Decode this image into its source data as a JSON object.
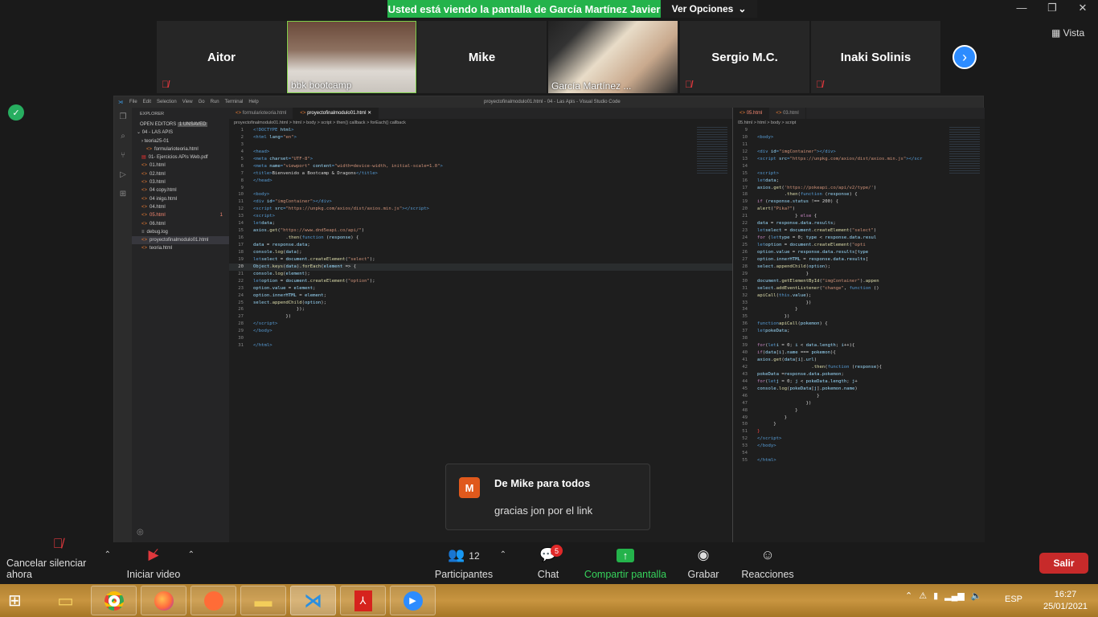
{
  "zoom": {
    "banner": "Usted está viendo la pantalla de García Martínez Javier",
    "view_options": "Ver Opciones",
    "view_label": "Vista",
    "participants": [
      {
        "name": "Aitor",
        "muted": true
      },
      {
        "name": "bbk bootcamp",
        "video": true
      },
      {
        "name": "Mike",
        "muted": false
      },
      {
        "name": "García Martínez ...",
        "video": true
      },
      {
        "name": "Sergio M.C.",
        "muted": true
      },
      {
        "name": "Inaki Solinis",
        "muted": true
      }
    ],
    "chat_notification": {
      "initial": "M",
      "from": "De Mike para todos",
      "message": "gracias jon por el link"
    },
    "toolbar": {
      "mute": "Cancelar silenciar ahora",
      "video": "Iniciar video",
      "participants": "Participantes",
      "participants_count": "12",
      "chat": "Chat",
      "chat_badge": "5",
      "share": "Compartir pantalla",
      "record": "Grabar",
      "reactions": "Reacciones",
      "leave": "Salir"
    },
    "colors": {
      "share": "#24b34b",
      "leave": "#c72a2a",
      "accent": "#2d8cff"
    }
  },
  "vscode": {
    "title": "proyectofinalmodulo01.html - 04 - Las Apis - Visual Studio Code",
    "menu": [
      "File",
      "Edit",
      "Selection",
      "View",
      "Go",
      "Run",
      "Terminal",
      "Help"
    ],
    "explorer": {
      "title": "EXPLORER",
      "open_editors": "OPEN EDITORS",
      "unsaved": "1 UNSAVED",
      "folder": "04 - LAS APIS",
      "files": [
        {
          "name": "teoria25-01",
          "type": "folder"
        },
        {
          "name": "formularioteoria.html",
          "type": "html"
        },
        {
          "name": "01- Ejercicios APIs Web.pdf",
          "type": "pdf"
        },
        {
          "name": "01.html",
          "type": "html"
        },
        {
          "name": "02.html",
          "type": "html"
        },
        {
          "name": "03.html",
          "type": "html"
        },
        {
          "name": "04 copy.html",
          "type": "html"
        },
        {
          "name": "04 inigo.html",
          "type": "html"
        },
        {
          "name": "04.html",
          "type": "html"
        },
        {
          "name": "05.html",
          "type": "html",
          "badge": "1"
        },
        {
          "name": "06.html",
          "type": "html"
        },
        {
          "name": "debug.log",
          "type": "log"
        },
        {
          "name": "proyectofinalmodulo01.html",
          "type": "html",
          "selected": true
        },
        {
          "name": "teoria.html",
          "type": "html"
        }
      ]
    },
    "editor1": {
      "tabs": [
        "formularioteoria.html",
        "proyectofinalmodulo01.html"
      ],
      "breadcrumb": "proyectofinalmodulo01.html > html > body > script > then() callback > forEach() callback"
    },
    "editor2": {
      "tabs": [
        "05.html",
        "03.html"
      ],
      "breadcrumb": "05.html > html > body > script"
    }
  },
  "taskbar": {
    "lang": "ESP",
    "time": "16:27",
    "date": "25/01/2021"
  }
}
